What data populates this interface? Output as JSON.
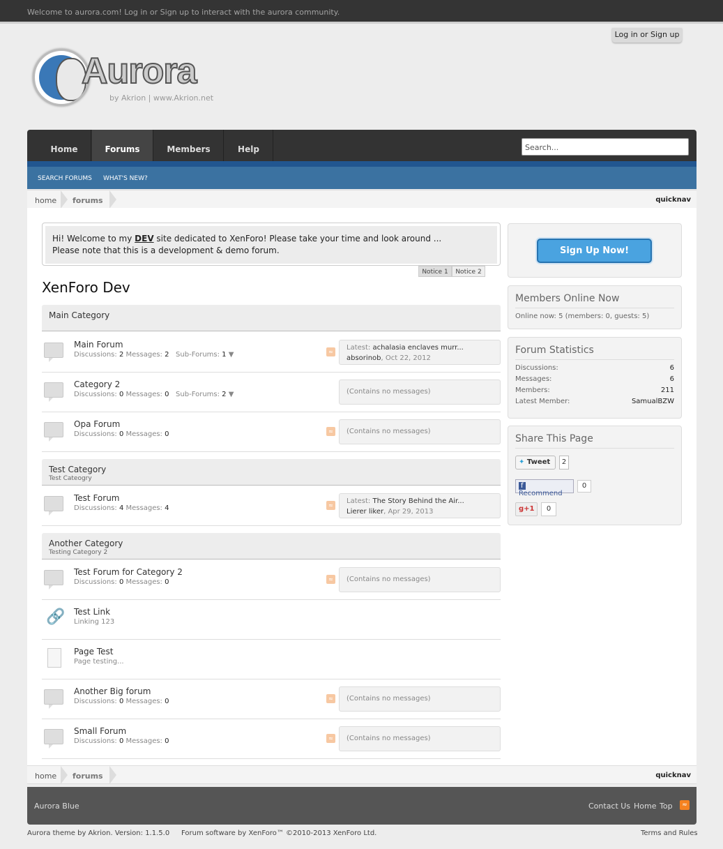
{
  "topbar": {
    "welcome": "Welcome to aurora.com! Log in or Sign up to interact with the aurora community.",
    "login_button": "Log in or Sign up"
  },
  "logo": {
    "word": "Aurora",
    "byline": "by Akrion | www.Akrion.net"
  },
  "nav": {
    "tabs": [
      "Home",
      "Forums",
      "Members",
      "Help"
    ],
    "active": "Forums",
    "search_placeholder": "Search...",
    "subnav": [
      "SEARCH FORUMS",
      "WHAT'S NEW?"
    ]
  },
  "breadcrumb": {
    "home": "home",
    "current": "forums",
    "quicknav": "quicknav"
  },
  "notice": {
    "line1_a": "Hi! Welcome to my ",
    "line1_b": "DEV",
    "line1_c": " site dedicated to XenForo! Please take your time and look around ...",
    "line2": "Please note that this is a development & demo forum.",
    "tabs": [
      "Notice 1",
      "Notice 2"
    ]
  },
  "page_title": "XenForo Dev",
  "categories": [
    {
      "name": "Main Category",
      "desc": ""
    },
    {
      "name": "Test Category",
      "desc": "Test Cateogry"
    },
    {
      "name": "Another Category",
      "desc": "Testing Category 2"
    }
  ],
  "forums": [
    {
      "name": "Main Forum",
      "disc_label": "Discussions:",
      "disc": "2",
      "msg_label": "Messages:",
      "msg": "2",
      "sub_label": "Sub-Forums:",
      "sub": "1",
      "latest_label": "Latest:",
      "latest_title": "achalasia enclaves murr...",
      "latest_user": "absorinob",
      "latest_date": ", Oct 22, 2012"
    },
    {
      "name": "Category 2",
      "disc_label": "Discussions:",
      "disc": "0",
      "msg_label": "Messages:",
      "msg": "0",
      "sub_label": "Sub-Forums:",
      "sub": "2",
      "empty": "(Contains no messages)"
    },
    {
      "name": "Opa Forum",
      "disc_label": "Discussions:",
      "disc": "0",
      "msg_label": "Messages:",
      "msg": "0",
      "empty": "(Contains no messages)"
    },
    {
      "name": "Test Forum",
      "disc_label": "Discussions:",
      "disc": "4",
      "msg_label": "Messages:",
      "msg": "4",
      "latest_label": "Latest:",
      "latest_title": "The Story Behind the Air...",
      "latest_user": "Lierer liker",
      "latest_date": ", Apr 29, 2013"
    },
    {
      "name": "Test Forum for Category 2",
      "disc_label": "Discussions:",
      "disc": "0",
      "msg_label": "Messages:",
      "msg": "0",
      "empty": "(Contains no messages)"
    },
    {
      "name": "Test Link",
      "desc": "Linking 123"
    },
    {
      "name": "Page Test",
      "desc": "Page testing..."
    },
    {
      "name": "Another Big forum",
      "disc_label": "Discussions:",
      "disc": "0",
      "msg_label": "Messages:",
      "msg": "0",
      "empty": "(Contains no messages)"
    },
    {
      "name": "Small Forum",
      "disc_label": "Discussions:",
      "disc": "0",
      "msg_label": "Messages:",
      "msg": "0",
      "empty": "(Contains no messages)"
    }
  ],
  "sidebar": {
    "signup": "Sign Up Now!",
    "online": {
      "title": "Members Online Now",
      "text": "Online now: 5 (members: 0, guests: 5)"
    },
    "stats": {
      "title": "Forum Statistics",
      "rows": [
        {
          "k": "Discussions:",
          "v": "6"
        },
        {
          "k": "Messages:",
          "v": "6"
        },
        {
          "k": "Members:",
          "v": "211"
        },
        {
          "k": "Latest Member:",
          "v": "SamualBZW"
        }
      ]
    },
    "share": {
      "title": "Share This Page",
      "tweet": "Tweet",
      "tweet_count": "2",
      "recommend": "Recommend",
      "recommend_count": "0",
      "plusone": "+1",
      "plusone_count": "0"
    }
  },
  "footer": {
    "style": "Aurora Blue",
    "links": [
      "Contact Us",
      "Home",
      "Top"
    ],
    "credit1": "Aurora theme by Akrion. Version: 1.1.5.0",
    "credit2": "Forum software by XenForo™ ©2010-2013 XenForo Ltd.",
    "terms": "Terms and Rules"
  },
  "colors": {
    "nav": "#333333",
    "subnav": "#3b72a1",
    "accent": "#4aa3e0",
    "rss": "#f7c8a2"
  }
}
